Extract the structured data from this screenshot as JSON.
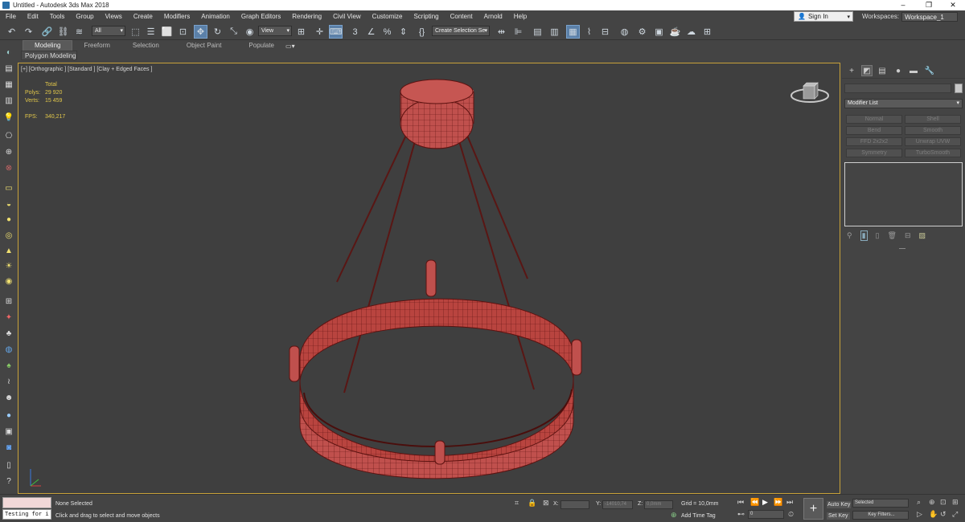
{
  "window": {
    "title": "Untitled - Autodesk 3ds Max 2018",
    "minimize": "–",
    "maximize": "❐",
    "close": "✕"
  },
  "menu": [
    "File",
    "Edit",
    "Tools",
    "Group",
    "Views",
    "Create",
    "Modifiers",
    "Animation",
    "Graph Editors",
    "Rendering",
    "Civil View",
    "Customize",
    "Scripting",
    "Content",
    "Arnold",
    "Help"
  ],
  "signin": {
    "label": "Sign In"
  },
  "workspaces": {
    "label": "Workspaces:",
    "value": "Workspace_1"
  },
  "toolbar": {
    "filter_value": "All",
    "refcoord_value": "View",
    "selection_set_placeholder": "Create Selection Se"
  },
  "ribbon": {
    "tabs": [
      "Modeling",
      "Freeform",
      "Selection",
      "Object Paint",
      "Populate"
    ],
    "sub_label": "Polygon Modeling"
  },
  "viewport": {
    "label": "[+] [Orthographic ] [Standard ] [Clay + Edged Faces ]",
    "stats": {
      "total_label": "Total",
      "polys_label": "Polys:",
      "polys_value": "29 920",
      "verts_label": "Verts:",
      "verts_value": "15 459",
      "fps_label": "FPS:",
      "fps_value": "340,217"
    }
  },
  "command_panel": {
    "modifier_list": "Modifier List",
    "modifier_buttons": [
      "Normal",
      "Shell",
      "Bend",
      "Smooth",
      "FFD 2x2x2",
      "Unwrap UVW",
      "Symmetry",
      "TurboSmooth"
    ]
  },
  "status": {
    "maxscript_text": "Testing for i",
    "selection": "None Selected",
    "prompt": "Click and drag to select and move objects",
    "x_label": "X:",
    "y_label": "Y:",
    "y_value": "-14010,74",
    "z_label": "Z:",
    "z_value": "0,0mm",
    "grid": "Grid = 10,0mm",
    "add_time_tag": "Add Time Tag",
    "frame_value": "0",
    "auto_key": "Auto Key",
    "set_key": "Set Key",
    "selected_dd": "Selected",
    "key_filters": "Key Filters..."
  },
  "colors": {
    "viewport_bg": "#3f3f3f",
    "mesh": "#c0504d",
    "wire": "#5c1210",
    "active_border": "#c8a23a",
    "stats_text": "#e2c74a"
  }
}
